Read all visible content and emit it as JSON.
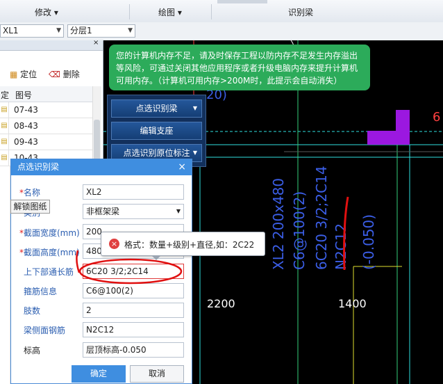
{
  "ribbon": {
    "modify_label": "修改",
    "draw_label": "绘图",
    "identify_beam_label": "识别梁"
  },
  "toolbar": {
    "element_combo": "XL1",
    "layer_combo": "分层1"
  },
  "left_panel": {
    "locate_label": "定位",
    "delete_label": "删除",
    "col_partial": "定",
    "col_drawing": "图号",
    "rows": [
      "07-43",
      "08-43",
      "09-43",
      "10-43"
    ]
  },
  "toast": {
    "message": "您的计算机内存不足，请及时保存工程以防内存不足发生内存溢出等风险，可通过关闭其他应用程序或者升级电脑内存来提升计算机可用内存。（计算机可用内存>200M时，此提示会自动消失）"
  },
  "menu": {
    "items": [
      "点选识别梁",
      "编辑支座",
      "点选识别原位标注"
    ]
  },
  "dialog": {
    "title": "点选识别梁",
    "fields": [
      {
        "label": "名称",
        "required": true,
        "value": "XL2"
      },
      {
        "label": "类别",
        "required": true,
        "value": "非框架梁"
      },
      {
        "label": "截面宽度(mm)",
        "required": true,
        "value": "200"
      },
      {
        "label": "截面高度(mm)",
        "required": true,
        "value": "480"
      },
      {
        "label": "上下部通长筋",
        "required": false,
        "value": "6C20 3/2;2C14"
      },
      {
        "label": "箍筋信息",
        "required": false,
        "value": "C6@100(2)"
      },
      {
        "label": "肢数",
        "required": false,
        "value": "2"
      },
      {
        "label": "梁侧面钢筋",
        "required": false,
        "value": "N2C12"
      },
      {
        "label": "标高",
        "required": false,
        "value": "层顶标高-0.050"
      }
    ],
    "ok_label": "确定",
    "cancel_label": "取消"
  },
  "tooltip_unlock": "解锁图纸",
  "error_tip": "格式：数量+级别+直径,如：2C22",
  "cad": {
    "dim_left": "2200",
    "dim_right": "1400",
    "annotations": [
      "XL2 200x480",
      "C6@100(2)",
      "6C20 3/2;2C14",
      "N2C12",
      "(-0.050)"
    ],
    "top_fragment": "20)"
  },
  "colors": {
    "accent": "#3f8ee0",
    "toast_bg": "#2cab5a",
    "cad_bg": "#000000",
    "annotation": "#3b5ee6",
    "markup_red": "#e01010"
  }
}
